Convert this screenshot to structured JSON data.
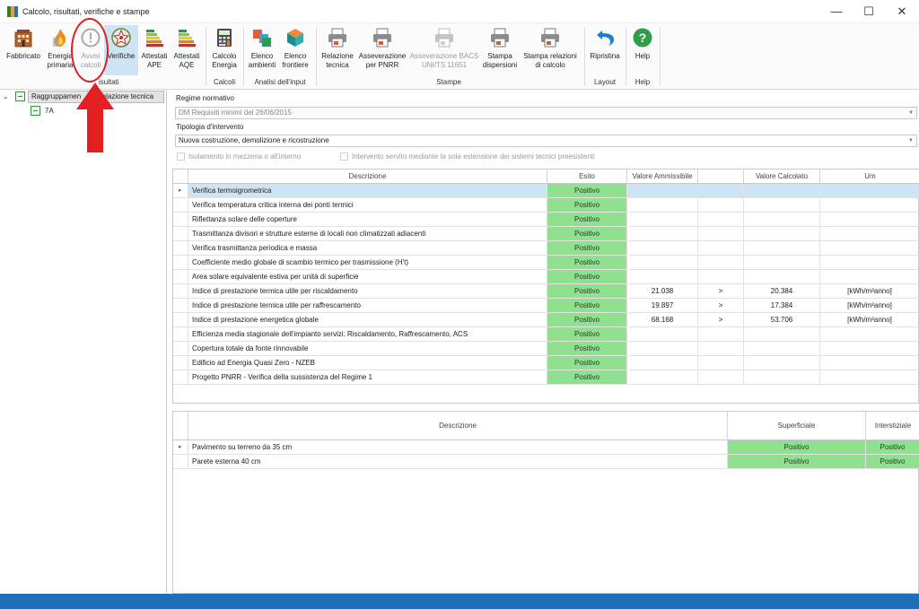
{
  "window": {
    "title": "Calcolo, risultati, verifiche e stampe",
    "minimize_glyph": "—",
    "maximize_glyph": "☐",
    "close_glyph": "✕"
  },
  "ribbon": {
    "buttons": [
      {
        "label": "Fabbricato",
        "icon": "building-icon",
        "enabled": true
      },
      {
        "label": "Energia\nprimaria",
        "icon": "fire-icon",
        "enabled": true
      },
      {
        "label": "Avvisi\ncalcoli",
        "icon": "warning-icon",
        "enabled": false
      },
      {
        "label": "Verifiche",
        "icon": "emblem-icon",
        "enabled": true,
        "active": true
      },
      {
        "label": "Attestati\nAPE",
        "icon": "energy-label-icon",
        "enabled": true
      },
      {
        "label": "Attestati\nAQE",
        "icon": "energy-label-icon",
        "enabled": true
      },
      {
        "label": "Calcolo\nEnergia",
        "icon": "calculator-icon",
        "enabled": true
      },
      {
        "label": "Elenco\nambienti",
        "icon": "rooms-icon",
        "enabled": true
      },
      {
        "label": "Elenco\nfrontiere",
        "icon": "cube-icon",
        "enabled": true
      },
      {
        "label": "Relazione\ntecnica",
        "icon": "printer-icon",
        "enabled": true
      },
      {
        "label": "Asseverazione\nper PNRR",
        "icon": "printer-icon",
        "enabled": true
      },
      {
        "label": "Asseverazione BACS\nUNI/TS 11651",
        "icon": "printer-icon",
        "enabled": false
      },
      {
        "label": "Stampa\ndispersioni",
        "icon": "printer-icon",
        "enabled": true
      },
      {
        "label": "Stampa relazioni\ndi calcolo",
        "icon": "printer-icon",
        "enabled": true
      },
      {
        "label": "Ripristina",
        "icon": "undo-icon",
        "enabled": true
      },
      {
        "label": "Help",
        "icon": "help-icon",
        "enabled": true
      }
    ],
    "groups": [
      "Risultati",
      "Calcoli",
      "Analisi dell'input",
      "Stampe",
      "Layout",
      "Help"
    ],
    "groups_visible": [
      "isultati",
      "Calcoli",
      "Analisi dell'input",
      "Stampe",
      "Layout",
      "Help"
    ]
  },
  "tree": {
    "root_label": "Raggruppamento relazione tecnica",
    "root_label_visible_left": "Raggruppamen",
    "root_label_visible_right": "relazione tecnica",
    "child_label": "7A"
  },
  "form": {
    "regime_label": "Regime normativo",
    "regime_value": "DM Requisiti minimi del 26/06/2015",
    "tipologia_label": "Tipologia d'intervento",
    "tipologia_value": "Nuova costruzione, demolizione e ricostruzione",
    "check1": "Isolamento in mezzeria o all'interno",
    "check2": "Intervento servito mediante la sola estensione dei sistemi tecnici preesistenti"
  },
  "verifiche_table": {
    "headers": [
      "Descrizione",
      "Esito",
      "Valore Ammissibile",
      "",
      "Valore Calcolato",
      "Um"
    ],
    "rows": [
      {
        "desc": "Verifica termoigrometrica",
        "esito": "Positivo",
        "amm": "",
        "op": "",
        "calc": "",
        "um": ""
      },
      {
        "desc": "Verifica temperatura critica interna dei ponti termici",
        "esito": "Positivo",
        "amm": "",
        "op": "",
        "calc": "",
        "um": ""
      },
      {
        "desc": "Riflettanza solare delle coperture",
        "esito": "Positivo",
        "amm": "",
        "op": "",
        "calc": "",
        "um": ""
      },
      {
        "desc": "Trasmittanza divisori e strutture esterne di locali non climatizzati adiacenti",
        "esito": "Positivo",
        "amm": "",
        "op": "",
        "calc": "",
        "um": ""
      },
      {
        "desc": "Verifica trasmittanza periodica e massa",
        "esito": "Positivo",
        "amm": "",
        "op": "",
        "calc": "",
        "um": ""
      },
      {
        "desc": "Coefficiente medio globale di scambio termico per trasmissione (H't)",
        "esito": "Positivo",
        "amm": "",
        "op": "",
        "calc": "",
        "um": ""
      },
      {
        "desc": "Area solare equivalente estiva per unità di superficie",
        "esito": "Positivo",
        "amm": "",
        "op": "",
        "calc": "",
        "um": ""
      },
      {
        "desc": "Indice di prestazione termica utile per riscaldamento",
        "esito": "Positivo",
        "amm": "21.038",
        "op": ">",
        "calc": "20.384",
        "um": "[kWh/m²anno]"
      },
      {
        "desc": "Indice di prestazione termica utile per raffrescamento",
        "esito": "Positivo",
        "amm": "19.897",
        "op": ">",
        "calc": "17.384",
        "um": "[kWh/m²anno]"
      },
      {
        "desc": "Indice di prestazione energetica globale",
        "esito": "Positivo",
        "amm": "68.168",
        "op": ">",
        "calc": "53.706",
        "um": "[kWh/m²anno]"
      },
      {
        "desc": "Efficienza media stagionale dell'impianto servizi: Riscaldamento, Raffrescamento, ACS",
        "esito": "Positivo",
        "amm": "",
        "op": "",
        "calc": "",
        "um": ""
      },
      {
        "desc": "Copertura totale da fonte rinnovabile",
        "esito": "Positivo",
        "amm": "",
        "op": "",
        "calc": "",
        "um": ""
      },
      {
        "desc": "Edificio ad Energia Quasi Zero - NZEB",
        "esito": "Positivo",
        "amm": "",
        "op": "",
        "calc": "",
        "um": ""
      },
      {
        "desc": "Progetto PNRR - Verifica della sussistenza del Regime 1",
        "esito": "Positivo",
        "amm": "",
        "op": "",
        "calc": "",
        "um": ""
      }
    ]
  },
  "condensa_table": {
    "headers": [
      "Descrizione",
      "Superficiale",
      "Interstiziale"
    ],
    "rows": [
      {
        "desc": "Pavimento su terreno da 35 cm",
        "sup": "Positivo",
        "int": "Positivo"
      },
      {
        "desc": "Parete esterna 40 cm",
        "sup": "Positivo",
        "int": "Positivo"
      }
    ]
  },
  "colors": {
    "positive": "#8fe08f",
    "selection": "#cfe3f6",
    "statusbar": "#1f6fb8",
    "annotation": "#d32222"
  }
}
